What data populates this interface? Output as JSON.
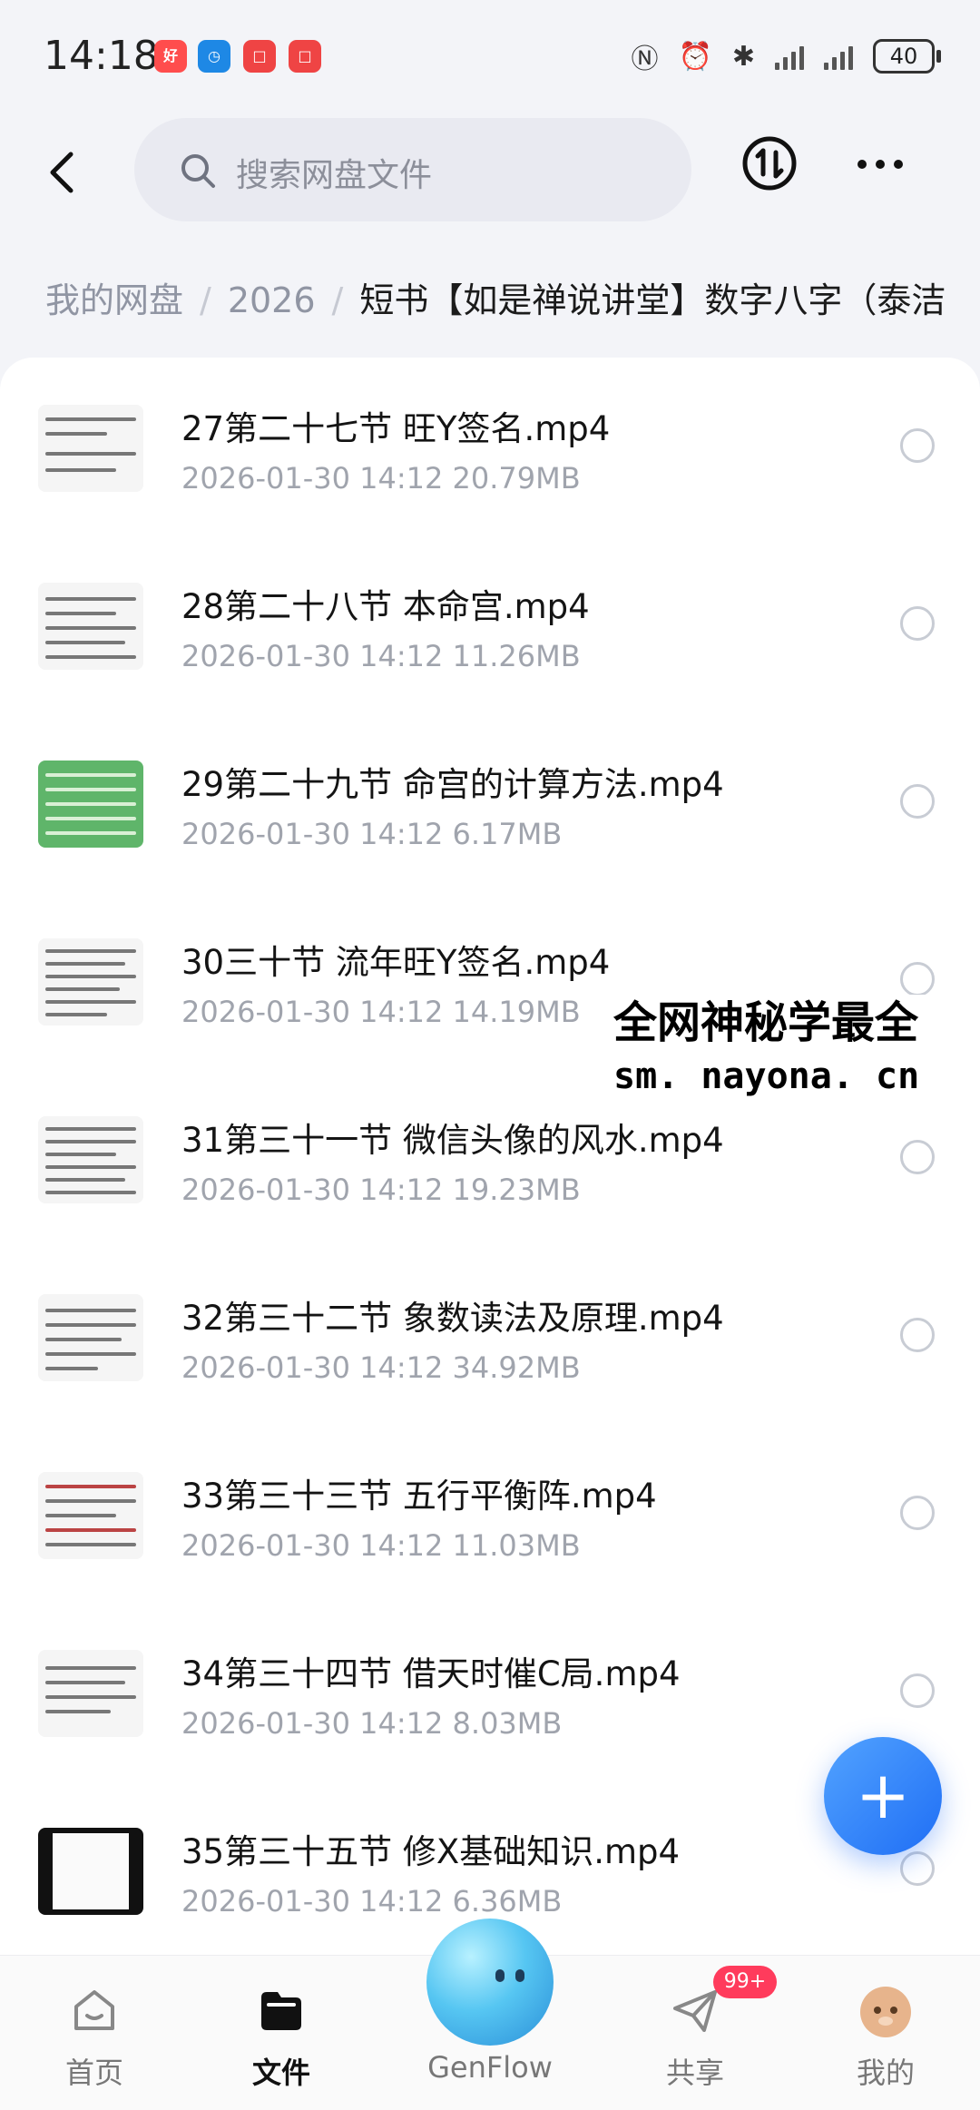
{
  "status": {
    "time": "14:18",
    "apps": [
      {
        "name": "shopping-app-icon",
        "label": "好",
        "color": "#ff4d4d"
      },
      {
        "name": "alarm-app-icon",
        "label": "◷",
        "color": "#1e88e5"
      },
      {
        "name": "red-app-icon-1",
        "label": "□",
        "color": "#ef4444"
      },
      {
        "name": "red-app-icon-2",
        "label": "□",
        "color": "#ef4444"
      }
    ],
    "battery": "40"
  },
  "header": {
    "search_placeholder": "搜索网盘文件"
  },
  "breadcrumb": {
    "root": "我的网盘",
    "year": "2026",
    "current": "短书【如是禅说讲堂】数字八字（泰洁"
  },
  "files": [
    {
      "title": "27第二十七节 旺Y签名.mp4",
      "date": "2026-01-30",
      "time": "14:12",
      "size": "20.79MB"
    },
    {
      "title": "28第二十八节 本命宫.mp4",
      "date": "2026-01-30",
      "time": "14:12",
      "size": "11.26MB"
    },
    {
      "title": "29第二十九节 命宫的计算方法.mp4",
      "date": "2026-01-30",
      "time": "14:12",
      "size": "6.17MB"
    },
    {
      "title": "30三十节 流年旺Y签名.mp4",
      "date": "2026-01-30",
      "time": "14:12",
      "size": "14.19MB"
    },
    {
      "title": "31第三十一节 微信头像的风水.mp4",
      "date": "2026-01-30",
      "time": "14:12",
      "size": "19.23MB"
    },
    {
      "title": "32第三十二节 象数读法及原理.mp4",
      "date": "2026-01-30",
      "time": "14:12",
      "size": "34.92MB"
    },
    {
      "title": "33第三十三节 五行平衡阵.mp4",
      "date": "2026-01-30",
      "time": "14:12",
      "size": "11.03MB"
    },
    {
      "title": "34第三十四节 借天时催C局.mp4",
      "date": "2026-01-30",
      "time": "14:12",
      "size": "8.03MB"
    },
    {
      "title": "35第三十五节 修X基础知识.mp4",
      "date": "2026-01-30",
      "time": "14:12",
      "size": "6.36MB"
    }
  ],
  "watermark": {
    "line1": "全网神秘学最全",
    "line2": "sm. nayona. cn"
  },
  "fab": {
    "label": "+"
  },
  "tabs": [
    {
      "label": "首页"
    },
    {
      "label": "文件"
    },
    {
      "label": "GenFlow"
    },
    {
      "label": "共享"
    },
    {
      "label": "我的"
    }
  ],
  "share_badge": "99+",
  "colors": {
    "accent": "#1f6ef5",
    "badge": "#ff3b5c",
    "meta_gray": "#a0a4ad"
  }
}
